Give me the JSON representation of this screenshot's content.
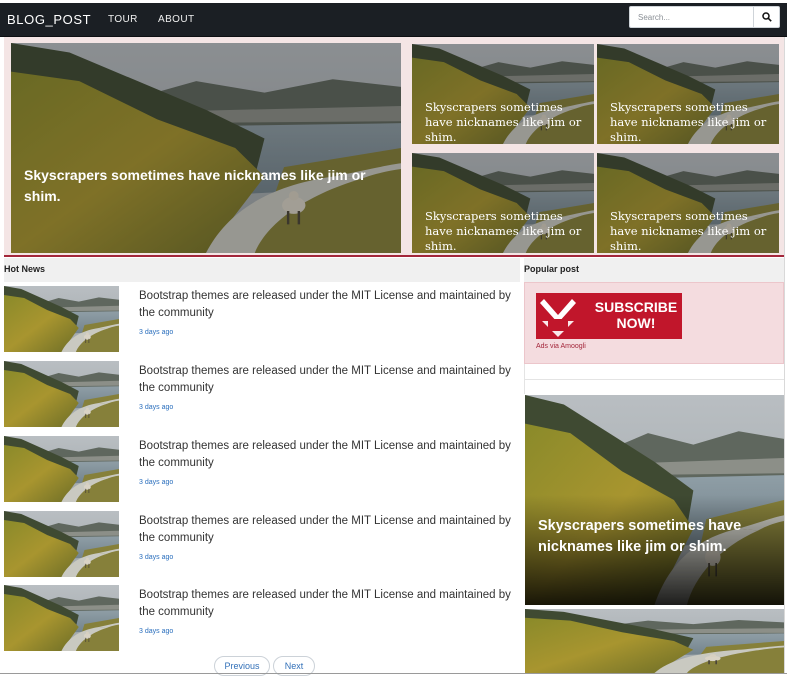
{
  "navbar": {
    "brand": "BLOG_POST",
    "links": [
      "TOUR",
      "ABOUT"
    ],
    "search_placeholder": "Search...",
    "search_icon": "search-icon"
  },
  "hero": {
    "main_caption": "Skyscrapers sometimes have nicknames like jim or shim.",
    "small_captions": [
      "Skyscrapers sometimes have nicknames like jim or shim.",
      "Skyscrapers sometimes have nicknames like jim or shim.",
      "Skyscrapers sometimes have nicknames like jim or shim.",
      "Skyscrapers sometimes have nicknames like jim or shim."
    ],
    "accent_color": "#a3263a"
  },
  "hot_news": {
    "heading": "Hot News",
    "items": [
      {
        "title": "Bootstrap themes are released under the MIT License and maintained by the community",
        "meta": "3 days ago"
      },
      {
        "title": "Bootstrap themes are released under the MIT License and maintained by the community",
        "meta": "3 days ago"
      },
      {
        "title": "Bootstrap themes are released under the MIT License and maintained by the community",
        "meta": "3 days ago"
      },
      {
        "title": "Bootstrap themes are released under the MIT License and maintained by the community",
        "meta": "3 days ago"
      },
      {
        "title": "Bootstrap themes are released under the MIT License and maintained by the community",
        "meta": "3 days ago"
      }
    ],
    "pager": {
      "previous": "Previous",
      "next": "Next"
    }
  },
  "popular": {
    "heading": "Popular post",
    "ad": {
      "banner_text": "SUBSCRIBE NOW!",
      "caption": "Ads via Amoogli"
    },
    "card_caption": "Skyscrapers sometimes have nicknames like jim or shim."
  }
}
